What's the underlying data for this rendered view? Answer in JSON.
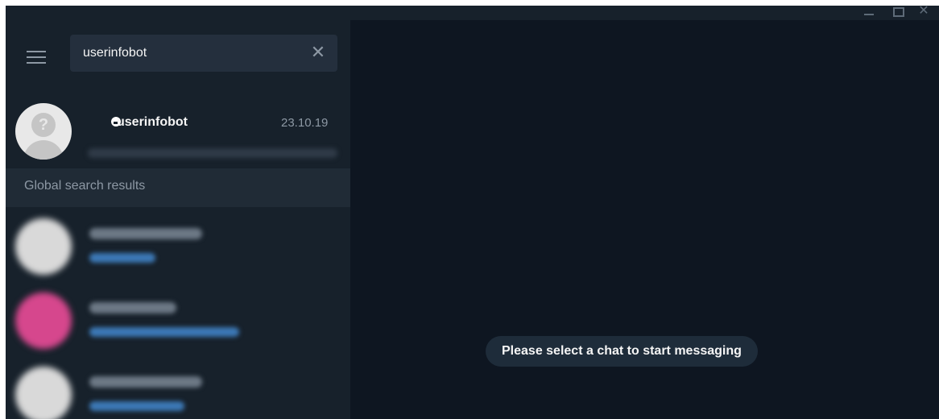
{
  "window": {
    "minimize_icon": "minimize-icon",
    "maximize_icon": "maximize-icon",
    "close_glyph": "✕"
  },
  "sidebar": {
    "menu_icon": "hamburger-menu-icon",
    "search": {
      "value": "userinfobot",
      "clear_glyph": "✕"
    },
    "chat": {
      "name": "userinfobot",
      "date": "23.10.19",
      "type_icon": "bot-icon"
    },
    "global_section_label": "Global search results",
    "results": [
      {
        "avatar_color": "#d9d9d9"
      },
      {
        "avatar_color": "#d6478d"
      },
      {
        "avatar_color": "#d9d9d9"
      }
    ]
  },
  "main": {
    "empty_message": "Please select a chat to start messaging"
  },
  "colors": {
    "sidebar_bg": "#17212b",
    "main_bg": "#0e1621",
    "search_bg": "#242f3d",
    "accent_link": "#3c78b5"
  }
}
